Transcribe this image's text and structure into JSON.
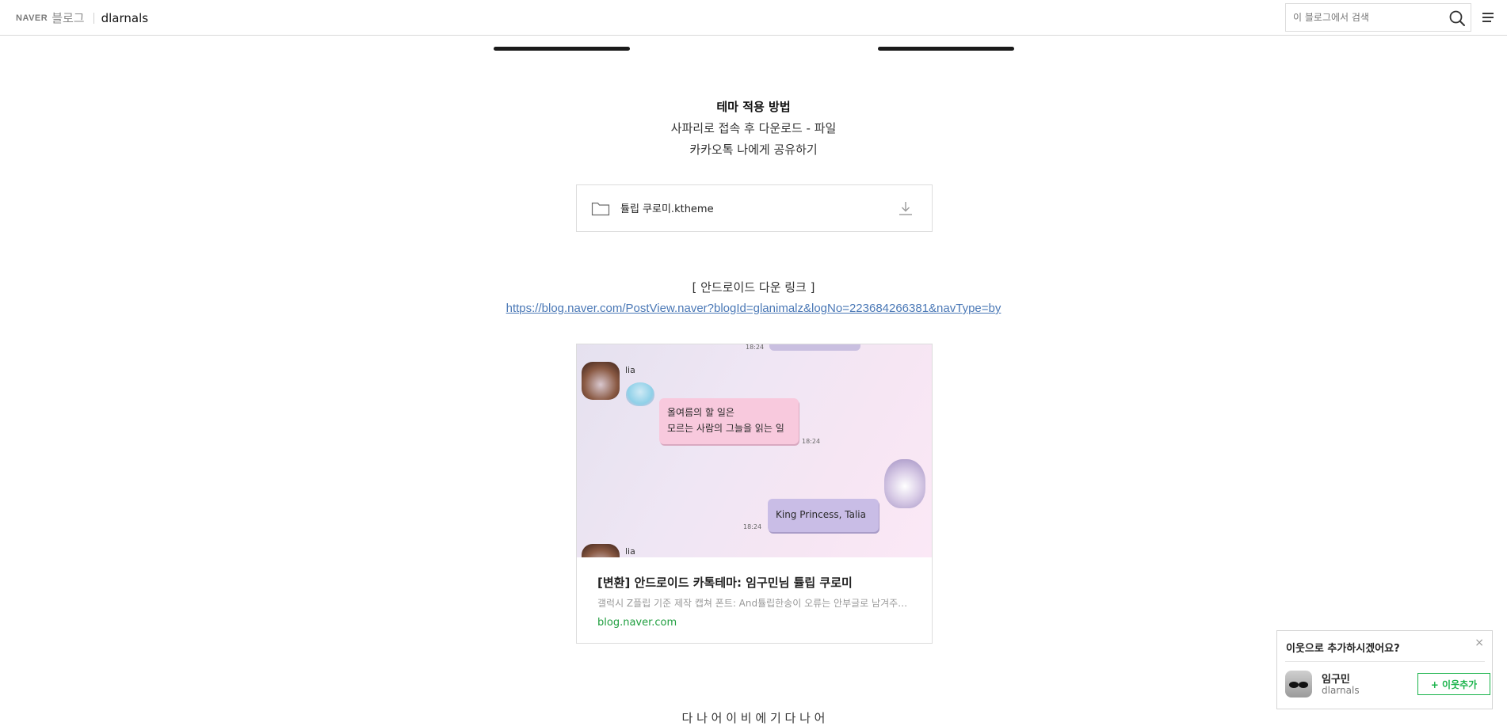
{
  "header": {
    "logo_text": "NAVER",
    "blog_word": "블로그",
    "blog_id": "dlarnals",
    "search_placeholder": "이 블로그에서 검색",
    "search_icon": "search-icon",
    "menu_icon": "hamburger-menu-icon"
  },
  "content": {
    "theme_title": "테마 적용 방법",
    "theme_lines": [
      "사파리로 접속 후 다운로드 - 파일",
      "카카오톡 나에게 공유하기"
    ],
    "file": {
      "name": "튤립 쿠로미.ktheme",
      "icon": "folder-icon",
      "action_icon": "download-icon"
    },
    "android_heading": "[ 안드로이드 다운 링크 ]",
    "android_url": "https://blog.naver.com/PostView.naver?blogId=glanimalz&logNo=223684266381&navType=by",
    "preview": {
      "image_texts": {
        "sender": "lia",
        "timestamp": "18:24",
        "msg_line1": "올여름의 할 일은",
        "msg_line2": "모르는 사람의 그늘을 읽는 일",
        "reply": "King Princess, Talia"
      },
      "title": "[변환] 안드로이드 카톡테마: 임구민님 튤립 쿠로미",
      "description": "갤럭시 Z플립 기준 제작 캡쳐 폰트: And튤립한송이 오류는 안부글로 남겨주세요",
      "domain": "blog.naver.com"
    },
    "bottom_cut_text": "다 나 어 이 비 에 기 다 나 어"
  },
  "neighbor_popup": {
    "question": "이웃으로 추가하시겠어요?",
    "close_label": "×",
    "name": "임구민",
    "id": "dlarnals",
    "add_label": "+ 이웃추가"
  },
  "colors": {
    "link": "#4a78b6",
    "domain_green": "#1e9e3e",
    "add_green": "#19b34a",
    "divider_bar": "#1a1a1a"
  }
}
